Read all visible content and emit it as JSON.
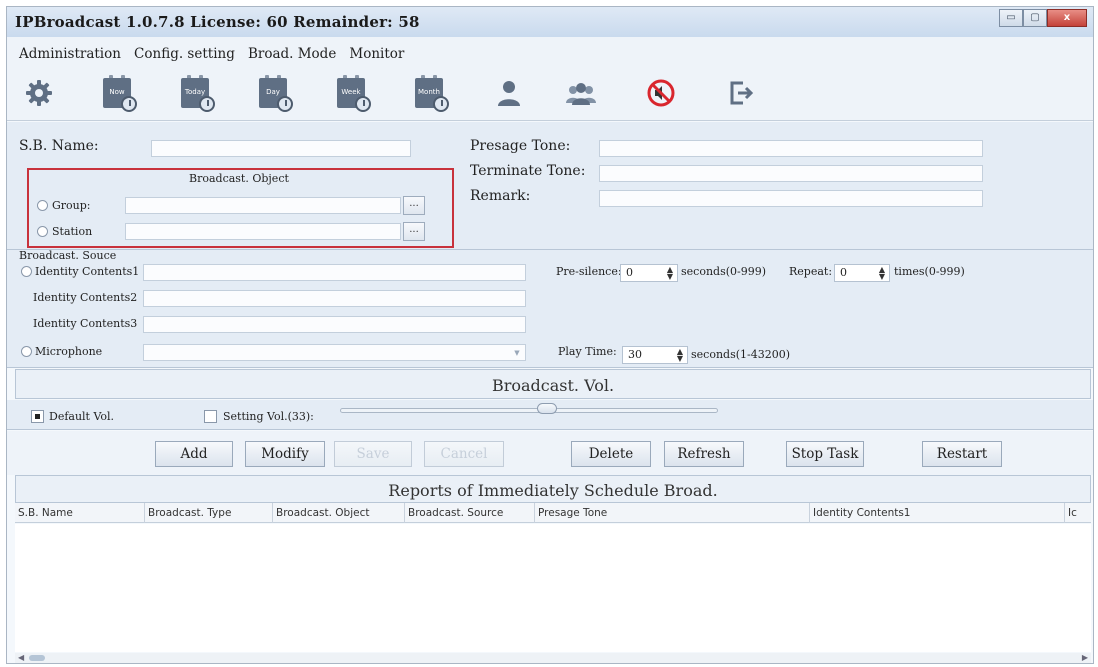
{
  "window": {
    "title": "IPBroadcast 1.0.7.8 License: 60 Remainder: 58",
    "minimize": "▭",
    "maximize": "▢",
    "close": "x"
  },
  "menu": [
    "Administration",
    "Config. setting",
    "Broad. Mode",
    "Monitor"
  ],
  "toolbar": {
    "now": "Now",
    "today": "Today",
    "day": "Day",
    "week": "Week",
    "month": "Month"
  },
  "form": {
    "sb_name_label": "S.B. Name:",
    "broadcast_object_label": "Broadcast. Object",
    "group_label": "Group:",
    "station_label": "Station",
    "browse": "...",
    "presage_tone_label": "Presage Tone:",
    "terminate_tone_label": "Terminate Tone:",
    "remark_label": "Remark:"
  },
  "source": {
    "title": "Broadcast. Souce",
    "identity1": "Identity Contents1",
    "identity2": "Identity Contents2",
    "identity3": "Identity Contents3",
    "microphone": "Microphone",
    "pre_silence_label": "Pre-silence:",
    "pre_silence_value": "0",
    "pre_silence_unit": "seconds(0-999)",
    "repeat_label": "Repeat:",
    "repeat_value": "0",
    "repeat_unit": "times(0-999)",
    "play_time_label": "Play Time:",
    "play_time_value": "30",
    "play_time_unit": "seconds(1-43200)"
  },
  "volume": {
    "title": "Broadcast. Vol.",
    "default_label": "Default Vol.",
    "setting_label": "Setting Vol.(33):",
    "level": 33
  },
  "buttons": {
    "add": "Add",
    "modify": "Modify",
    "save": "Save",
    "cancel": "Cancel",
    "delete": "Delete",
    "refresh": "Refresh",
    "stop_task": "Stop Task",
    "restart": "Restart"
  },
  "reports": {
    "title": "Reports of Immediately Schedule Broad.",
    "columns": [
      "S.B. Name",
      "Broadcast. Type",
      "Broadcast. Object",
      "Broadcast. Source",
      "Presage Tone",
      "Identity Contents1",
      "Ic"
    ]
  }
}
